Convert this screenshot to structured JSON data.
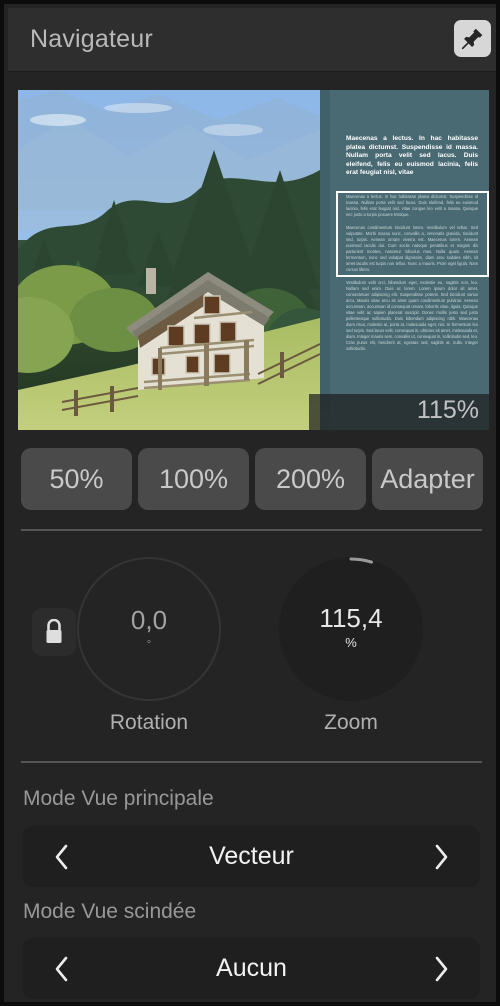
{
  "window": {
    "title": "Navigateur",
    "pin_icon": "pin-icon"
  },
  "preview": {
    "zoom_overlay_label": "115%",
    "document": {
      "heading": "Maecenas a lectus. In hac habitasse platea dictumst. Suspendisse id massa. Nullam porta velit sed lacus. Duis eleifend, felis eu euismod lacinia, felis erat feugiat nisl, vitae",
      "paragraphs": [
        "Maecenas a lectus. In hac habitasse platea dictumst. Suspendisse id massa. Nullam porta velit sed lacus. Duis eleifend, felis eu euismod lacinia, felis erat feugiat nisl, vitae congue leo velit a massa. Quisque nec justo a turpis posuere tristique.",
        "Maecenas condimentum tincidunt lorem. Vestibulum vel tellus. Sed vulputate. Morbi massa nunc, convallis a, venenatis gravida, tincidunt sed, turpis. Aenean ornare viverra est. Maecenas lorem. Aenean euismod iaculis dui. Cum sociis natoque penatibus et magnis dis parturient montes, nascetur ridiculus mus. Nulla quam. Aenean fermentum, nunc sed volutpat dignissim, diam arcu sodales nibh, sit amet iaculis est turpis non tellus. Nunc a mauris. Proin eget ligula. Nam cursus libero.",
        "Vestibulum velit orci, bibendum eget, molestie eu, sagittis non, leo. Nullam sed enim. Duis ac lorem. Lorem ipsum dolor sit amet, consectetuer adipiscing elit. Suspendisse potenti. Sed tincidunt varius arcu. Mauris vitae arcu sit amet quam condimentum pulvinar. Aenean accumsan, accumsan id consequat ornare, lobortis vitae, ligula. Quisque vitae velit ac sapien placerat suscipit. Donec mollis justo sed justo pellentesque sollicitudin. Duis bibendum adipiscing nibh. Maecenas diam risus, molestie at, porta at, malesuada eget, nisi. In fermentum leo sed turpis. Sed lacus velit, consequat in, ultricies sit amet, malesuada et, diam. Integer mauris sem, convallis ut, consequat in, sollicitudin sed, leo. Cras purus elit, hendrerit at, egestas sed, sagittis at, nulla. Integer sollicitudin."
      ]
    }
  },
  "presets": [
    {
      "label": "50%"
    },
    {
      "label": "100%"
    },
    {
      "label": "200%"
    },
    {
      "label": "Adapter"
    }
  ],
  "dials": {
    "lock_icon": "lock-icon",
    "rotation": {
      "value": "0,0",
      "unit": "°",
      "label": "Rotation"
    },
    "zoom": {
      "value": "115,4",
      "unit": "%",
      "label": "Zoom"
    }
  },
  "modes": {
    "main": {
      "label": "Mode Vue principale",
      "value": "Vecteur",
      "prev_icon": "chevron-left-icon",
      "next_icon": "chevron-right-icon"
    },
    "split": {
      "label": "Mode Vue scindée",
      "value": "Aucun",
      "prev_icon": "chevron-left-icon",
      "next_icon": "chevron-right-icon"
    }
  },
  "colors": {
    "window_bg": "#242424",
    "titlebar_bg": "#2e2e2e",
    "accent_document": "#4a6a73",
    "button_bg": "#4a4a4a"
  }
}
